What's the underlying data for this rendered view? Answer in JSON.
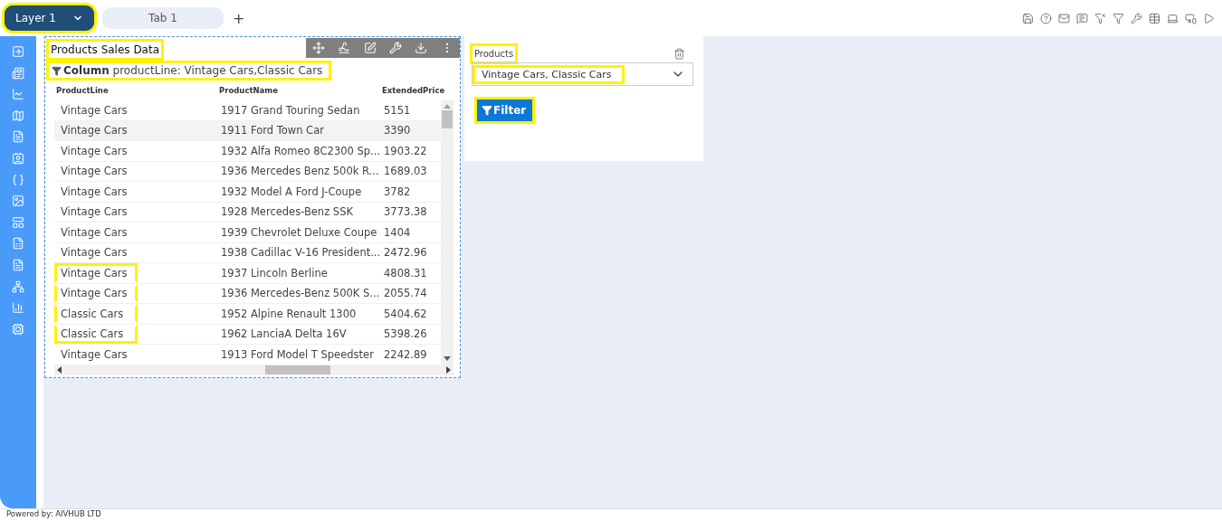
{
  "layer_tab": {
    "label": "Layer 1",
    "highlighted": true
  },
  "tabs": [
    {
      "label": "Tab 1",
      "selected": false
    }
  ],
  "add_tab": "+",
  "table_widget": {
    "title": "Products Sales Data",
    "title_highlighted": true,
    "filter": {
      "text": "**Column** productLine: Vintage Cars,Classic Cars",
      "highlighted": true
    },
    "columns": [
      "ProductLine",
      "ProductName",
      "ExtendedPrice"
    ],
    "rows": [
      {
        "cells": [
          "Vintage Cars",
          "1917 Grand Touring Sedan",
          "5151"
        ],
        "selected": false,
        "highlighted": false
      },
      {
        "cells": [
          "Vintage Cars",
          "1911 Ford Town Car",
          "3390"
        ],
        "selected": true,
        "highlighted": false
      },
      {
        "cells": [
          "Vintage Cars",
          "1932 Alfa Romeo 8C2300 Sp...",
          "1903.22"
        ],
        "selected": false,
        "highlighted": false
      },
      {
        "cells": [
          "Vintage Cars",
          "1936 Mercedes Benz 500k R...",
          "1689.03"
        ],
        "selected": false,
        "highlighted": false
      },
      {
        "cells": [
          "Vintage Cars",
          "1932 Model A Ford J-Coupe",
          "3782"
        ],
        "selected": false,
        "highlighted": false
      },
      {
        "cells": [
          "Vintage Cars",
          "1928 Mercedes-Benz SSK",
          "3773.38"
        ],
        "selected": false,
        "highlighted": false
      },
      {
        "cells": [
          "Vintage Cars",
          "1939 Chevrolet Deluxe Coupe",
          "1404"
        ],
        "selected": false,
        "highlighted": false
      },
      {
        "cells": [
          "Vintage Cars",
          "1938 Cadillac V-16 President...",
          "2472.96"
        ],
        "selected": false,
        "highlighted": false
      },
      {
        "cells": [
          "Vintage Cars",
          "1937 Lincoln Berline",
          "4808.31"
        ],
        "selected": false,
        "highlighted": true
      },
      {
        "cells": [
          "Vintage Cars",
          "1936 Mercedes-Benz 500K S...",
          "2055.74"
        ],
        "selected": false,
        "highlighted": true
      },
      {
        "cells": [
          "Classic Cars",
          "1952 Alpine Renault 1300",
          "5404.62"
        ],
        "selected": false,
        "highlighted": true
      },
      {
        "cells": [
          "Classic Cars",
          "1962 LanciaA Delta 16V",
          "5398.26"
        ],
        "selected": false,
        "highlighted": true
      },
      {
        "cells": [
          "Vintage Cars",
          "1913 Ford Model T Speedster",
          "2242.89"
        ],
        "selected": false,
        "highlighted": false
      }
    ]
  },
  "filter_widget": {
    "label": "Products",
    "label_highlighted": true,
    "value": "Vintage Cars, Classic Cars",
    "value_highlighted": true,
    "button": {
      "label": "Filter",
      "highlighted": true
    }
  },
  "footer": "Powered by: AIVHUB LTD"
}
